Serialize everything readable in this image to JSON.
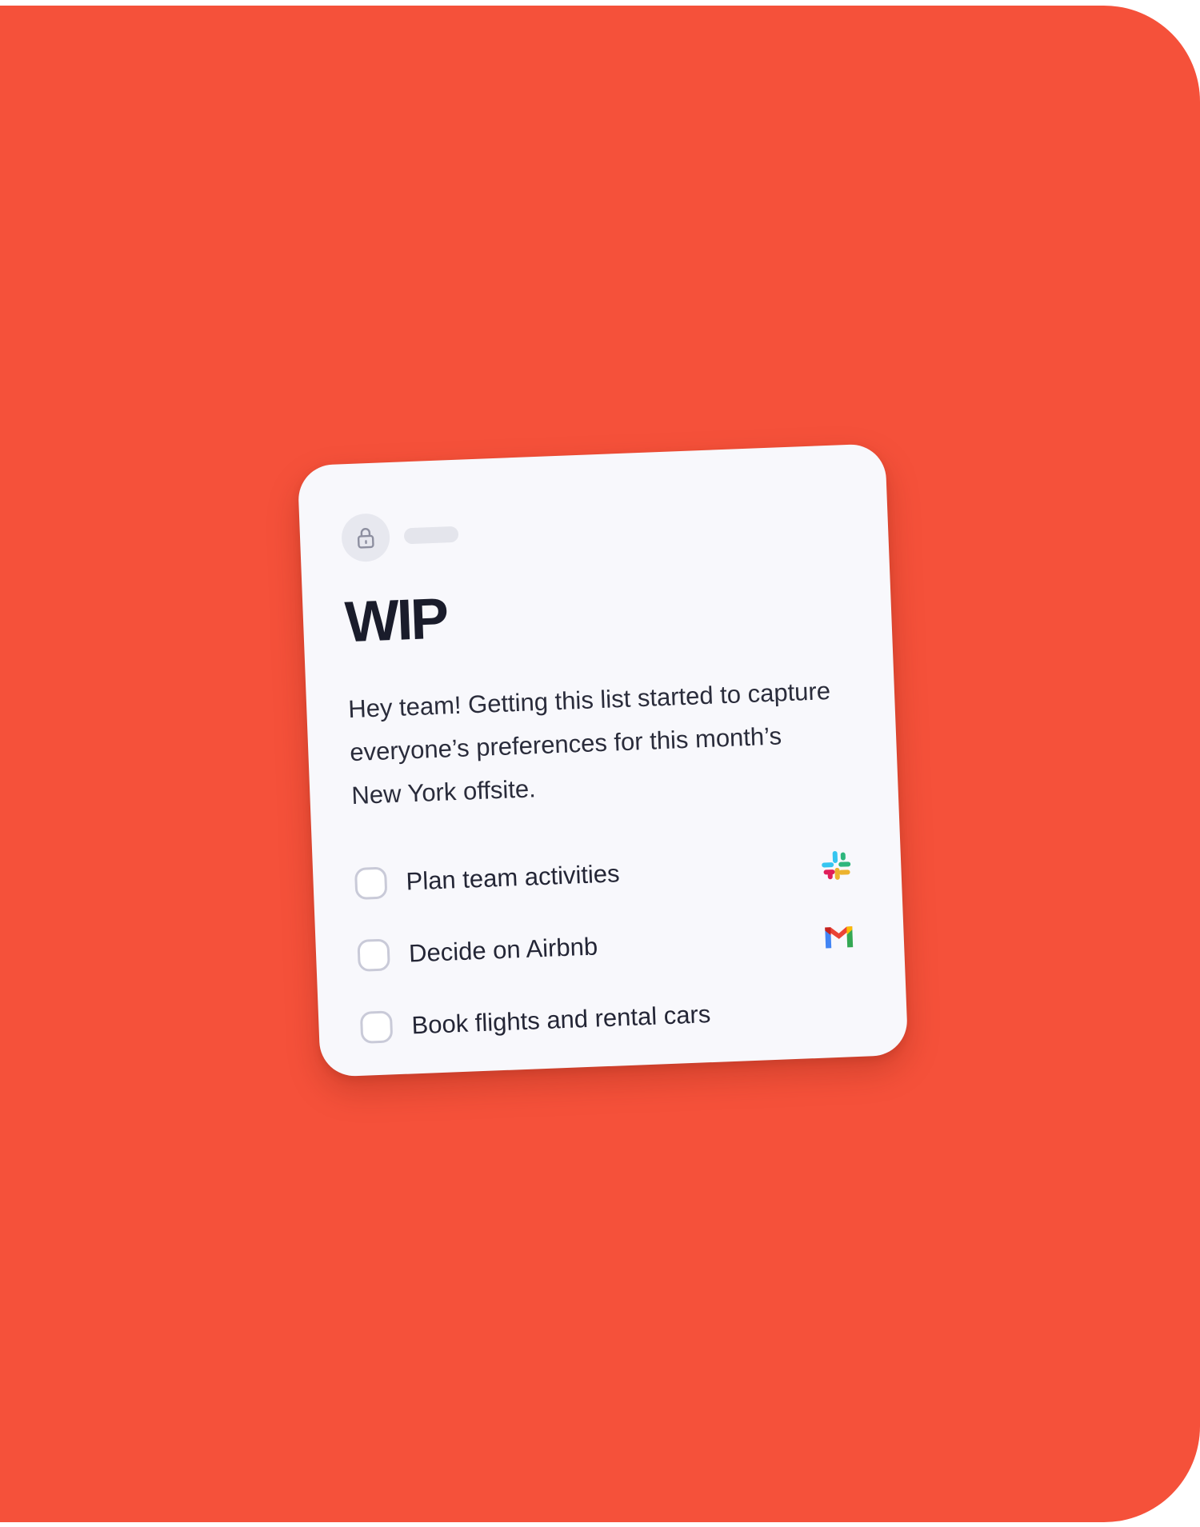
{
  "card": {
    "lock_icon": "lock-icon",
    "title": "WIP",
    "description": "Hey team! Getting this list started to capture everyone’s preferences for this month’s New York offsite.",
    "tasks": [
      {
        "label": "Plan team activities",
        "checked": false,
        "app_icon": "slack-icon"
      },
      {
        "label": "Decide on Airbnb",
        "checked": false,
        "app_icon": "gmail-icon"
      },
      {
        "label": "Book flights and rental cars",
        "checked": false,
        "app_icon": ""
      }
    ]
  },
  "colors": {
    "background": "#f5513a",
    "card": "#f8f8fc",
    "text": "#1a1c2b"
  }
}
